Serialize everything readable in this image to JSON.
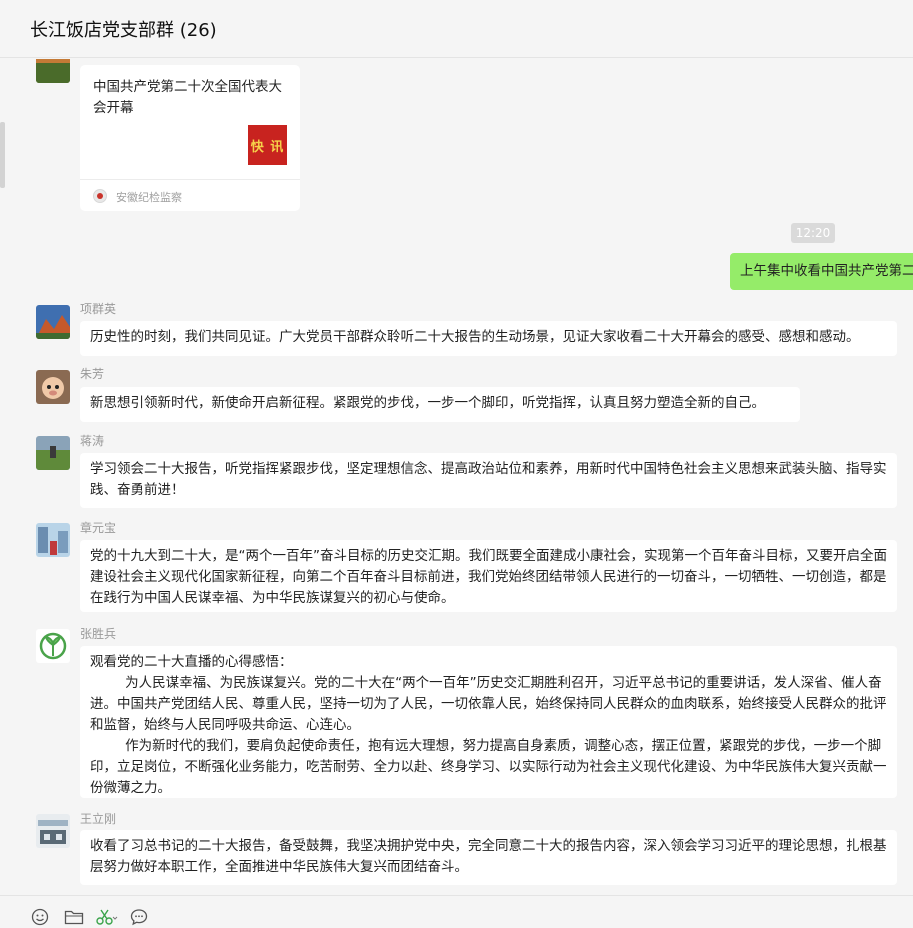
{
  "window": {
    "title": "长江饭店党支部群 (26)"
  },
  "messages": [
    {
      "type": "link_card",
      "card_title": "中国共产党第二十次全国代表大会开幕",
      "thumb_text": "快 讯",
      "source": "安徽纪检监察"
    },
    {
      "type": "timestamp",
      "text": "12:20"
    },
    {
      "type": "self",
      "text": "上午集中收看中国共产党第二十次全国代表大会开幕会"
    },
    {
      "type": "text",
      "sender": "项群英",
      "lines": [
        "历史性的时刻，我们共同见证。广大党员干部群众聆听二十大报告的生动场景，见证大家收看二十大开幕会的感受、感想和感动。"
      ]
    },
    {
      "type": "text",
      "sender": "朱芳",
      "lines": [
        "新思想引领新时代，新使命开启新征程。紧跟党的步伐，一步一个脚印，听党指挥，认真且努力塑造全新的自己。"
      ]
    },
    {
      "type": "text",
      "sender": "蒋涛",
      "lines": [
        "学习领会二十大报告，听党指挥紧跟步伐，坚定理想信念、提高政治站位和素养，用新时代中国特色社会主义思想来武装头脑、指导实践、奋勇前进！"
      ]
    },
    {
      "type": "text",
      "sender": "章元宝",
      "lines": [
        "党的十九大到二十大，是“两个一百年”奋斗目标的历史交汇期。我们既要全面建成小康社会，实现第一个百年奋斗目标，又要开启全面建设社会主义现代化国家新征程，向第二个百年奋斗目标前进，我们党始终团结带领人民进行的一切奋斗，一切牺牲、一切创造，都是在践行为中国人民谋幸福、为中华民族谋复兴的初心与使命。"
      ]
    },
    {
      "type": "text",
      "sender": "张胜兵",
      "lines": [
        "观看党的二十大直播的心得感悟：",
        "为人民谋幸福、为民族谋复兴。党的二十大在“两个一百年”历史交汇期胜利召开，习近平总书记的重要讲话，发人深省、催人奋进。中国共产党团结人民、尊重人民，坚持一切为了人民，一切依靠人民，始终保持同人民群众的血肉联系，始终接受人民群众的批评和监督，始终与人民同呼吸共命运、心连心。",
        "作为新时代的我们，要肩负起使命责任，抱有远大理想，努力提高自身素质，调整心态，摆正位置，紧跟党的步伐，一步一个脚印，立足岗位，不断强化业务能力，吃苦耐劳、全力以赴、终身学习、以实际行动为社会主义现代化建设、为中华民族伟大复兴贡献一份微薄之力。"
      ]
    },
    {
      "type": "text",
      "sender": "王立刚",
      "lines": [
        "收看了习总书记的二十大报告，备受鼓舞，我坚决拥护党中央，完全同意二十大的报告内容，深入领会学习习近平的理论思想，扎根基层努力做好本职工作，全面推进中华民族伟大复兴而团结奋斗。"
      ]
    }
  ],
  "toolbar": {
    "icons": [
      "emoji-icon",
      "folder-icon",
      "scissors-icon",
      "chat-bubble-icon"
    ]
  },
  "colors": {
    "background": "#f5f5f5",
    "self_bubble": "#95ec69",
    "other_bubble": "#ffffff",
    "sender_name": "#999999"
  }
}
